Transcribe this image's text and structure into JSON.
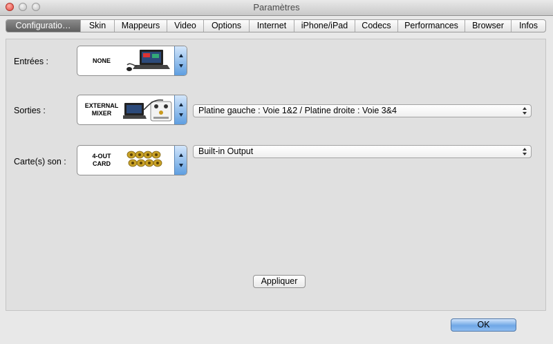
{
  "window": {
    "title": "Paramètres"
  },
  "tabs": [
    {
      "label": "Configuratio…",
      "active": true
    },
    {
      "label": "Skin"
    },
    {
      "label": "Mappeurs"
    },
    {
      "label": "Video"
    },
    {
      "label": "Options"
    },
    {
      "label": "Internet"
    },
    {
      "label": "iPhone/iPad"
    },
    {
      "label": "Codecs"
    },
    {
      "label": "Performances"
    },
    {
      "label": "Browser"
    },
    {
      "label": "Infos"
    }
  ],
  "rows": {
    "entrees": {
      "label": "Entrées :",
      "device": "NONE"
    },
    "sorties": {
      "label": "Sorties :",
      "device": "EXTERNAL\nMIXER",
      "select_value": "Platine gauche : Voie 1&2 / Platine droite : Voie 3&4"
    },
    "carte": {
      "label": "Carte(s) son :",
      "device": "4-OUT\nCARD",
      "select_value": "Built-in Output"
    }
  },
  "buttons": {
    "apply": "Appliquer",
    "ok": "OK"
  },
  "icons": {
    "entrees": "laptop-with-mouse-icon",
    "sorties": "laptop-mixer-icon",
    "carte": "rca-connectors-icon"
  },
  "colors": {
    "active_tab": "#6f6f6f",
    "stepper": "#5e9ee0",
    "ok_button": "#6fa7e6"
  }
}
